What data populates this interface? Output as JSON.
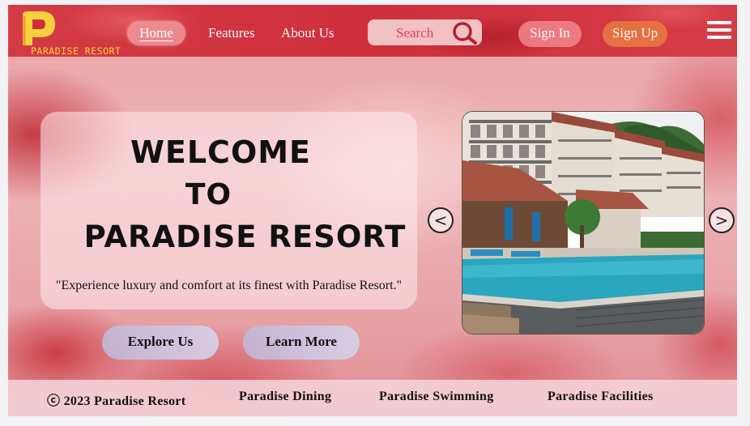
{
  "brand": {
    "logo_text": "PARADISE RESORT"
  },
  "nav": {
    "links": [
      {
        "label": "Home"
      },
      {
        "label": "Features"
      },
      {
        "label": "About Us"
      }
    ],
    "search_label": "Search",
    "sign_in_label": "Sign In",
    "sign_up_label": "Sign  Up"
  },
  "hero": {
    "title_line1": "WELCOME",
    "title_line2": "TO",
    "title_line3": "PARADISE RESORT",
    "tagline": "\"Experience luxury and comfort at its finest with Paradise Resort.\"",
    "explore_label": "Explore Us",
    "learn_label": "Learn More"
  },
  "carousel": {
    "prev_glyph": "<",
    "next_glyph": ">"
  },
  "footer": {
    "copyright": "ⓒ 2023 Paradise Resort",
    "dining": "Paradise Dining",
    "swimming": "Paradise Swimming",
    "facilities": "Paradise Facilities"
  },
  "colors": {
    "nav_red": "#cf2f3c",
    "logo_yellow": "#f5d23c",
    "sign_up_orange": "#e6703f",
    "search_text": "#e04050"
  },
  "icons": [
    "logo-p-icon",
    "search-icon",
    "hamburger-menu-icon",
    "chevron-left-icon",
    "chevron-right-icon"
  ]
}
